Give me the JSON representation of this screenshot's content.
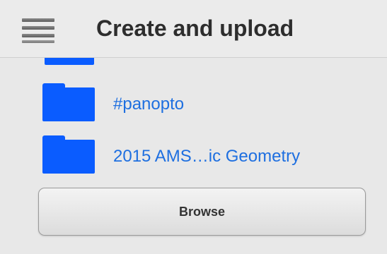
{
  "header": {
    "title": "Create and upload",
    "menu_icon": "hamburger-menu-icon"
  },
  "folders": [
    {
      "label": "#panopto",
      "icon": "folder-icon",
      "color": "#0a5cff"
    },
    {
      "label": "2015 AMS…ic Geometry",
      "icon": "folder-icon",
      "color": "#0a5cff"
    }
  ],
  "browse_button": {
    "label": "Browse"
  },
  "colors": {
    "accent": "#0a5cff",
    "link": "#1e6fe0",
    "background": "#e9e9e9"
  }
}
